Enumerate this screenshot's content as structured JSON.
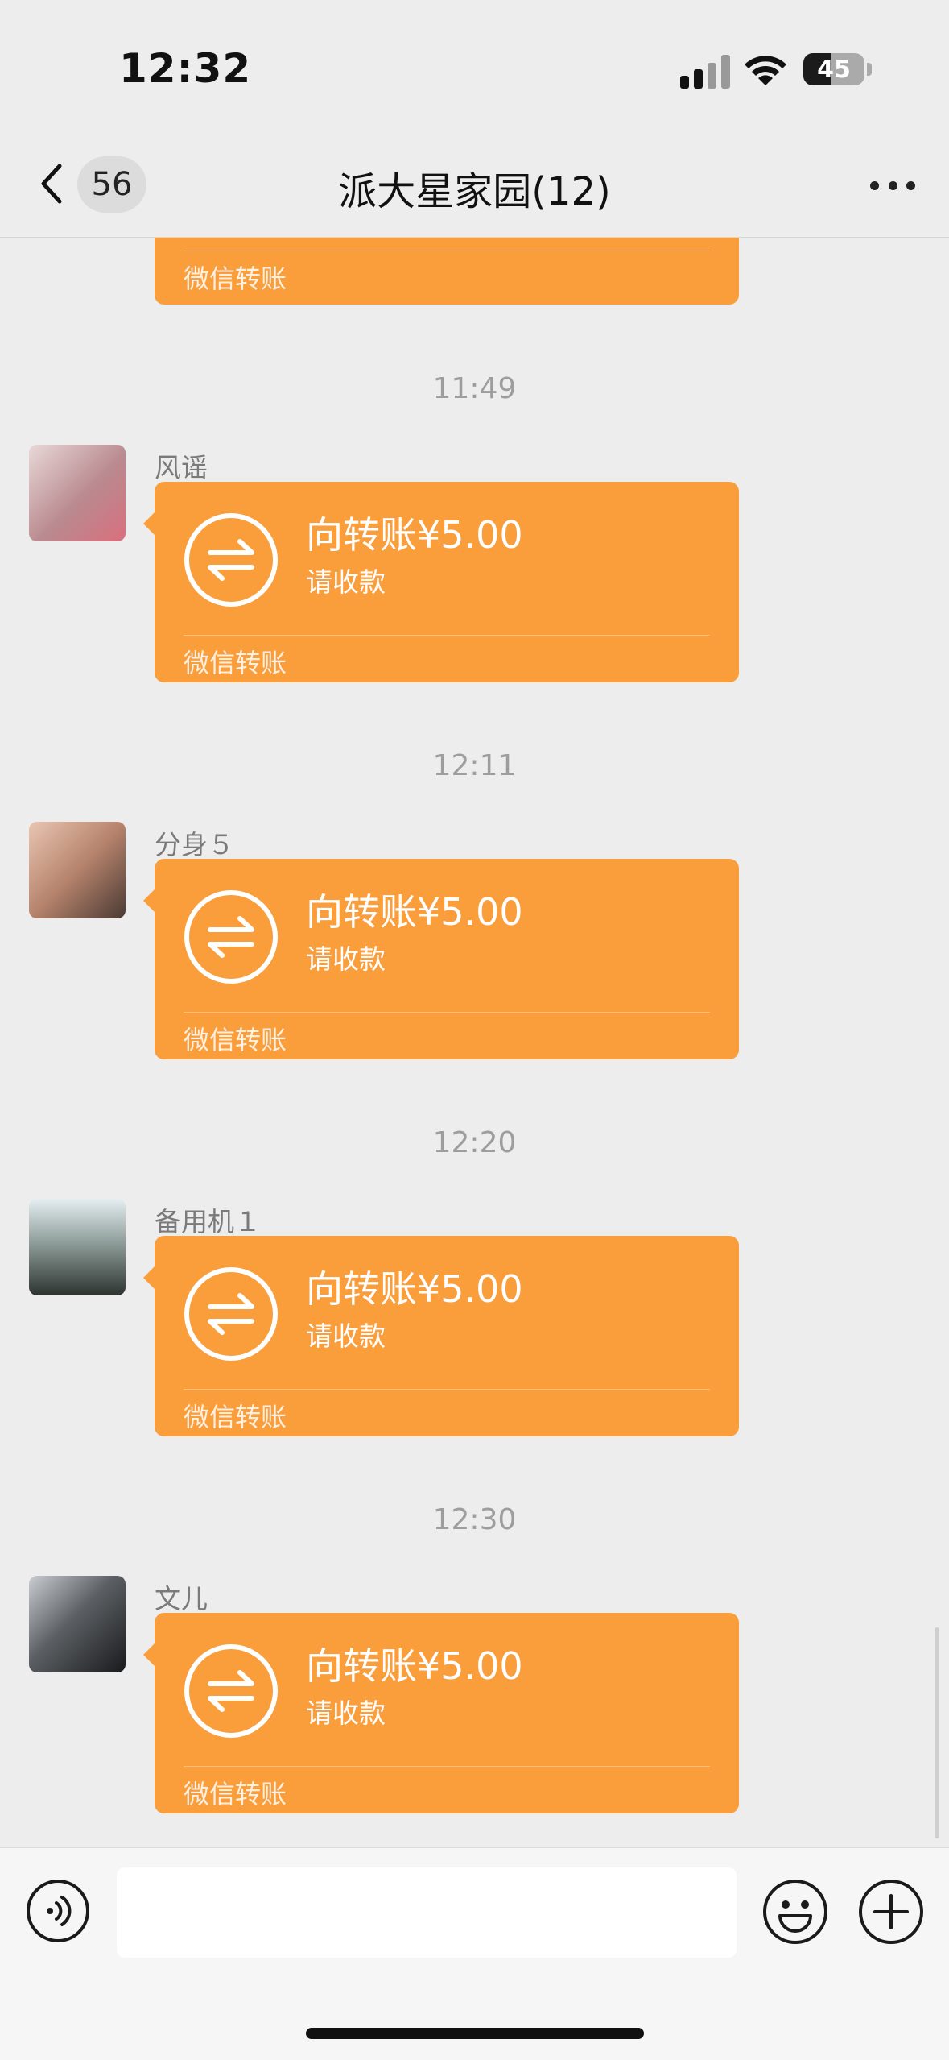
{
  "status_bar": {
    "time": "12:32",
    "battery_level": "45",
    "battery_fraction": 0.45
  },
  "nav": {
    "unread_count": "56",
    "title": "派大星家园(12)"
  },
  "partial_transfer": {
    "footer": "微信转账"
  },
  "messages": [
    {
      "timestamp": "11:49",
      "sender": "风谣",
      "amount": "向转账¥5.00",
      "status": "请收款",
      "footer": "微信转账"
    },
    {
      "timestamp": "12:11",
      "sender": "分身５",
      "amount": "向转账¥5.00",
      "status": "请收款",
      "footer": "微信转账"
    },
    {
      "timestamp": "12:20",
      "sender": "备用机１",
      "amount": "向转账¥5.00",
      "status": "请收款",
      "footer": "微信转账"
    },
    {
      "timestamp": "12:30",
      "sender": "文儿",
      "amount": "向转账¥5.00",
      "status": "请收款",
      "footer": "微信转账"
    }
  ],
  "colors": {
    "transfer_card": "#fa9d3b",
    "background": "#ededed"
  },
  "icons": {
    "back": "chevron-left-icon",
    "more": "more-dots-icon",
    "transfer": "transfer-arrows-icon",
    "voice": "voice-icon",
    "emoji": "emoji-icon",
    "plus": "plus-icon"
  }
}
